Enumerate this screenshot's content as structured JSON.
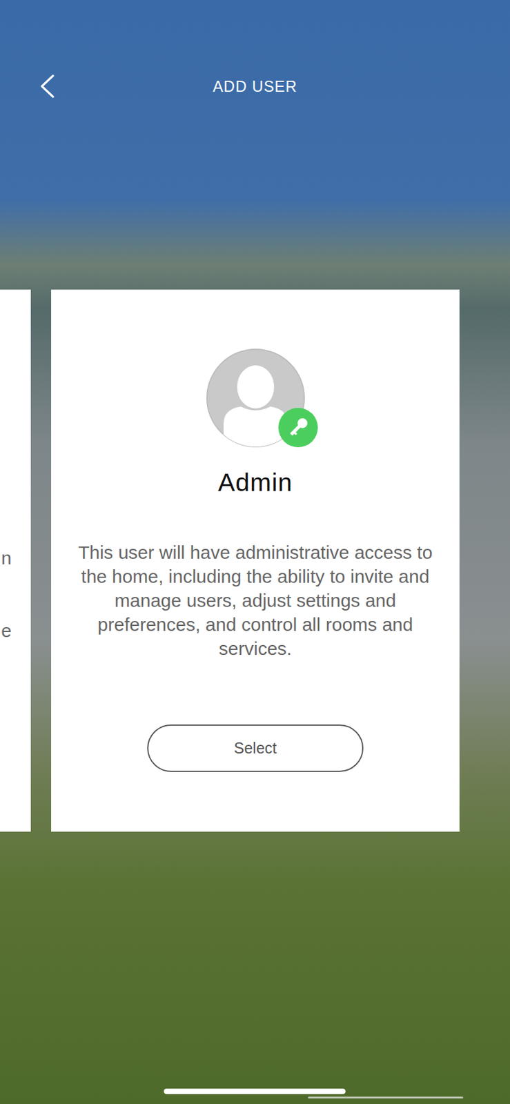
{
  "header": {
    "title": "ADD USER"
  },
  "previous_card": {
    "texts": [
      "n",
      "e"
    ]
  },
  "role_card": {
    "title": "Admin",
    "description": "This user will have administrative access to the home, including the ability to invite and manage users, adjust settings and preferences, and control all rooms and services.",
    "button": "Select"
  }
}
